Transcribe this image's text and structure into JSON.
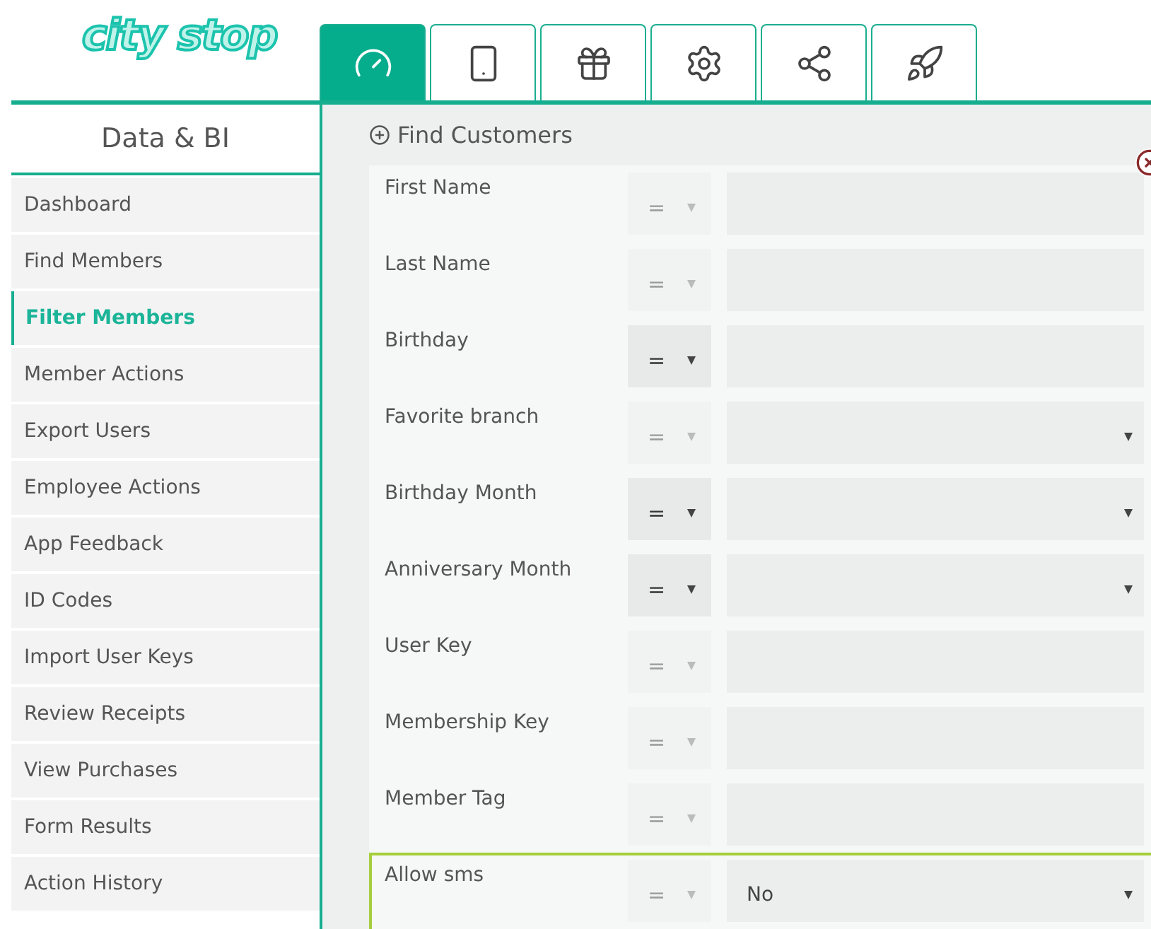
{
  "logo": "city stop",
  "tabs": [
    {
      "selected": true
    },
    {
      "selected": false
    },
    {
      "selected": false
    },
    {
      "selected": false
    },
    {
      "selected": false
    },
    {
      "selected": false
    }
  ],
  "sidebar": {
    "title": "Data & BI",
    "items": [
      {
        "label": "Dashboard",
        "selected": false
      },
      {
        "label": "Find Members",
        "selected": false
      },
      {
        "label": "Filter Members",
        "selected": true
      },
      {
        "label": "Member Actions",
        "selected": false
      },
      {
        "label": "Export Users",
        "selected": false
      },
      {
        "label": "Employee Actions",
        "selected": false
      },
      {
        "label": "App Feedback",
        "selected": false
      },
      {
        "label": "ID Codes",
        "selected": false
      },
      {
        "label": "Import User Keys",
        "selected": false
      },
      {
        "label": "Review Receipts",
        "selected": false
      },
      {
        "label": "View Purchases",
        "selected": false
      },
      {
        "label": "Form Results",
        "selected": false
      },
      {
        "label": "Action History",
        "selected": false
      }
    ]
  },
  "panel": {
    "title": "Find Customers",
    "fields": [
      {
        "label": "First Name",
        "operator": "=",
        "operator_disabled": true,
        "kind": "text",
        "highlighted": false
      },
      {
        "label": "Last Name",
        "operator": "=",
        "operator_disabled": true,
        "kind": "text",
        "highlighted": false
      },
      {
        "label": "Birthday",
        "operator": "=",
        "operator_disabled": false,
        "kind": "text",
        "highlighted": false
      },
      {
        "label": "Favorite branch",
        "operator": "=",
        "operator_disabled": true,
        "kind": "select",
        "highlighted": false
      },
      {
        "label": "Birthday Month",
        "operator": "=",
        "operator_disabled": false,
        "kind": "select",
        "highlighted": false
      },
      {
        "label": "Anniversary Month",
        "operator": "=",
        "operator_disabled": false,
        "kind": "select",
        "highlighted": false
      },
      {
        "label": "User Key",
        "operator": "=",
        "operator_disabled": true,
        "kind": "text",
        "highlighted": false
      },
      {
        "label": "Membership Key",
        "operator": "=",
        "operator_disabled": true,
        "kind": "text",
        "highlighted": false
      },
      {
        "label": "Member Tag",
        "operator": "=",
        "operator_disabled": true,
        "kind": "text",
        "highlighted": false
      },
      {
        "label": "Allow sms",
        "operator": "=",
        "operator_disabled": true,
        "kind": "select",
        "value": "No",
        "highlighted": true
      }
    ]
  }
}
